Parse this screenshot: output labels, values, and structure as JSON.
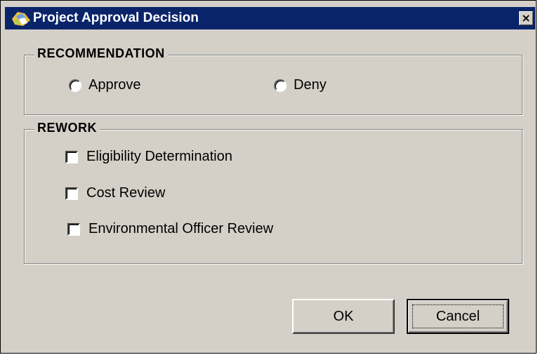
{
  "window": {
    "title": "Project Approval Decision",
    "close_label": "×",
    "title_icon": "project-app-icon"
  },
  "recommendation": {
    "label": "RECOMMENDATION",
    "options": [
      {
        "label": "Approve",
        "selected": false
      },
      {
        "label": "Deny",
        "selected": false
      }
    ]
  },
  "rework": {
    "label": "REWORK",
    "items": [
      {
        "label": "Eligibility Determination",
        "checked": false
      },
      {
        "label": "Cost Review",
        "checked": false
      },
      {
        "label": "Environmental Officer Review",
        "checked": false
      }
    ]
  },
  "buttons": {
    "ok_label": "OK",
    "cancel_label": "Cancel"
  },
  "colors": {
    "titlebar": "#0a246a",
    "dialog_face": "#d4d0c8"
  }
}
